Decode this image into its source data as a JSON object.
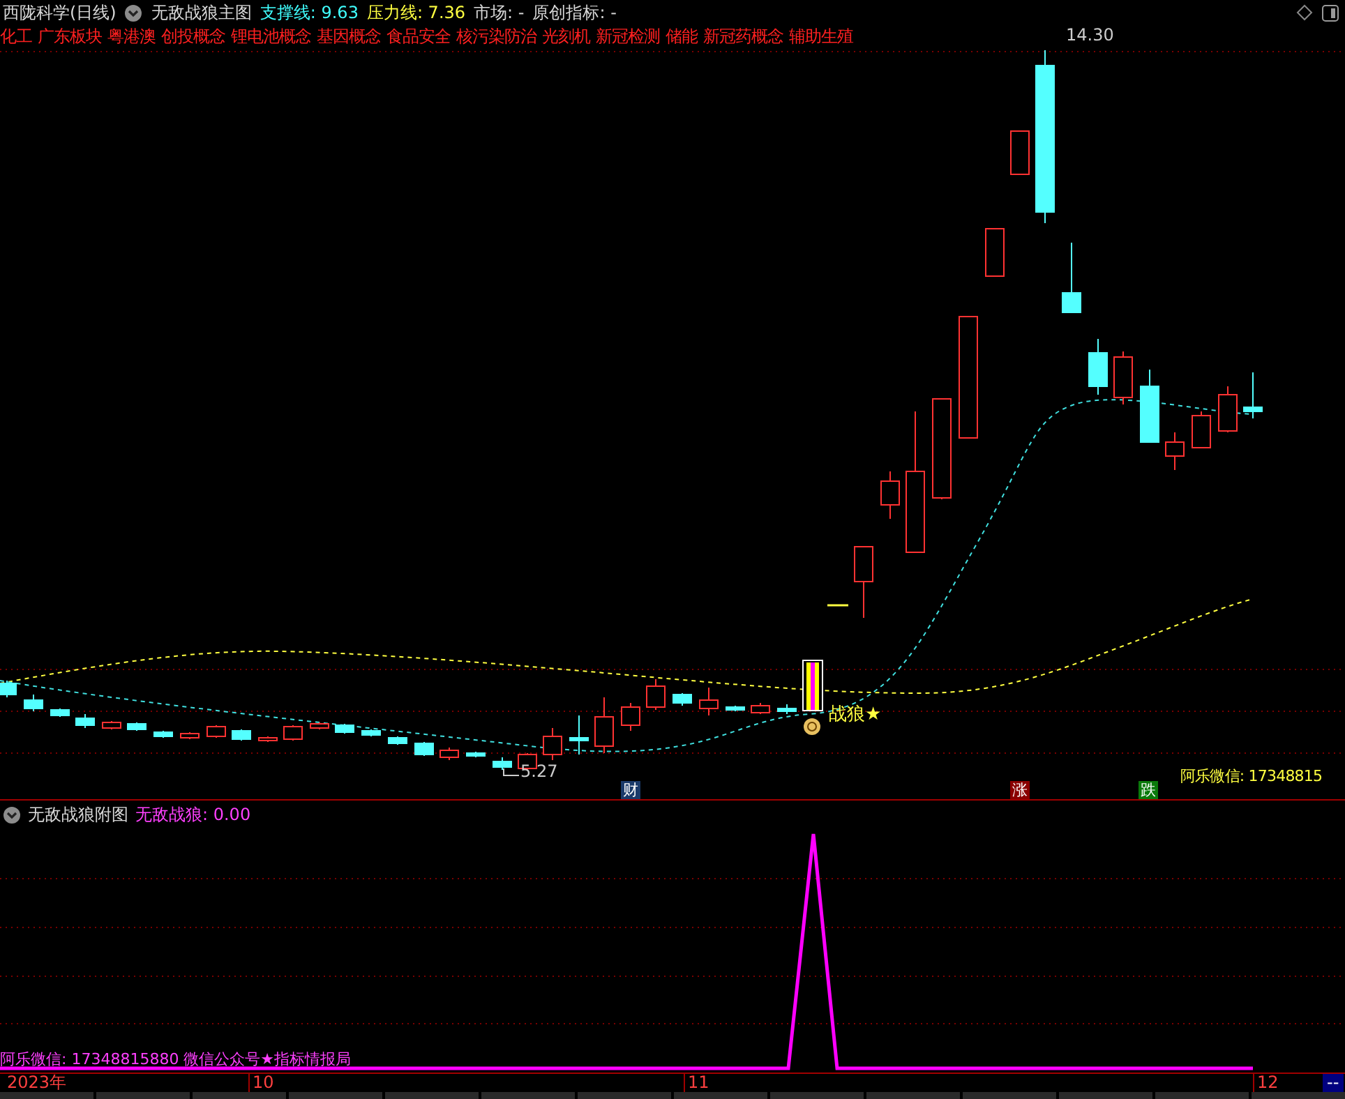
{
  "header": {
    "security": "西陇科学(日线)",
    "indicator": "无敌战狼主图",
    "readings": [
      {
        "kind": "support",
        "text": "支撑线: 9.63"
      },
      {
        "kind": "pressure",
        "text": "压力线: 7.36"
      },
      {
        "kind": "plain",
        "text": "市场: -"
      },
      {
        "kind": "plain",
        "text": "原创指标: -"
      }
    ]
  },
  "concepts": [
    "化工",
    "广东板块",
    "粤港澳",
    "创投概念",
    "锂电池概念",
    "基因概念",
    "食品安全",
    "核污染防治",
    "光刻机",
    "新冠检测",
    "储能",
    "新冠药概念",
    "辅助生殖"
  ],
  "main_chart": {
    "high_label": "14.30",
    "low_label": "5.27",
    "signal_label": "战狼★",
    "contact": "阿乐微信: 17348815",
    "badges": [
      {
        "kind": "cai",
        "text": "财"
      },
      {
        "kind": "zhang",
        "text": "涨"
      },
      {
        "kind": "die",
        "text": "跌"
      }
    ]
  },
  "sub_chart": {
    "title": "无敌战狼附图",
    "reading": "无敌战狼: 0.00",
    "footer": "阿乐微信: 17348815880 微信公众号★指标情报局"
  },
  "time_axis": [
    {
      "kind": "year",
      "text": "2023年"
    },
    {
      "kind": "month",
      "text": "10"
    },
    {
      "kind": "month",
      "text": "11"
    },
    {
      "kind": "month",
      "text": "12"
    },
    {
      "kind": "box",
      "text": "--"
    }
  ]
}
